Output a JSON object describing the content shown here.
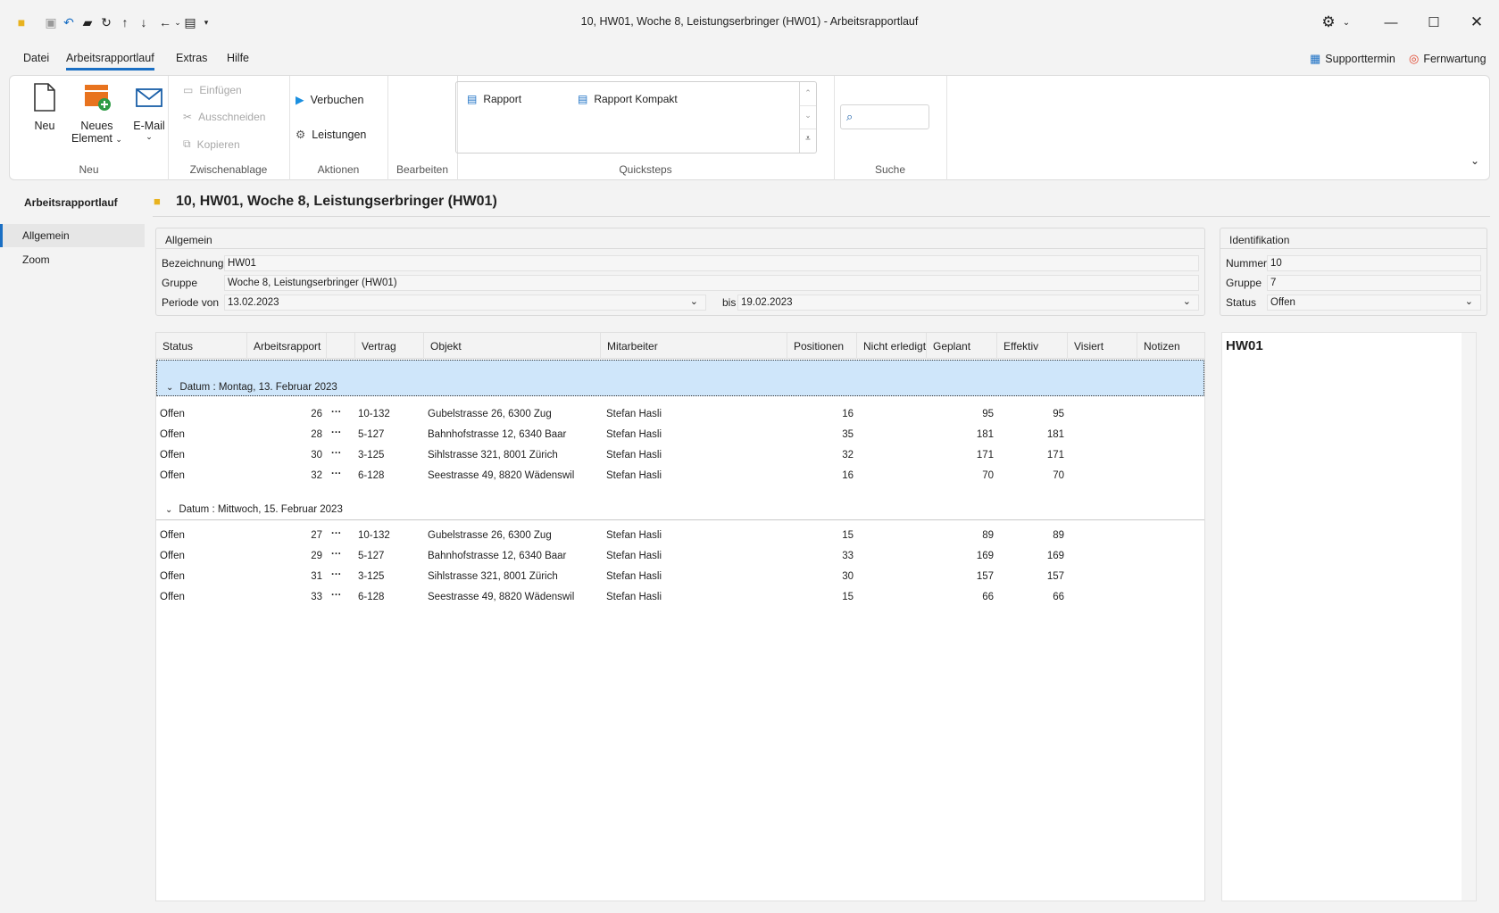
{
  "window": {
    "title": "10, HW01, Woche 8, Leistungserbringer (HW01) - Arbeitsrapportlauf"
  },
  "menu": {
    "tabs": [
      "Datei",
      "Arbeitsrapportlauf",
      "Extras",
      "Hilfe"
    ],
    "supporttermin": "Supporttermin",
    "fernwartung": "Fernwartung"
  },
  "ribbon": {
    "neu": "Neu",
    "neues_element_1": "Neues",
    "neues_element_2": "Element",
    "email": "E-Mail",
    "group_neu": "Neu",
    "einfuegen": "Einfügen",
    "ausschneiden": "Ausschneiden",
    "kopieren": "Kopieren",
    "group_zwischenablage": "Zwischenablage",
    "verbuchen": "Verbuchen",
    "leistungen": "Leistungen",
    "group_aktionen": "Aktionen",
    "group_bearbeiten": "Bearbeiten",
    "rapport": "Rapport",
    "rapport_kompakt": "Rapport Kompakt",
    "group_quicksteps": "Quicksteps",
    "group_suche": "Suche"
  },
  "sidebar": {
    "title": "Arbeitsrapportlauf",
    "items": [
      "Allgemein",
      "Zoom"
    ]
  },
  "page": {
    "title": "10, HW01, Woche 8, Leistungserbringer (HW01)"
  },
  "allgemein": {
    "title": "Allgemein",
    "bezeichnung_label": "Bezeichnung",
    "bezeichnung": "HW01",
    "gruppe_label": "Gruppe",
    "gruppe": "Woche 8, Leistungserbringer (HW01)",
    "periode_label": "Periode von",
    "periode_von": "13.02.2023",
    "bis_label": "bis",
    "bis": "19.02.2023"
  },
  "identifikation": {
    "title": "Identifikation",
    "nummer_label": "Nummer",
    "nummer": "10",
    "gruppe_label": "Gruppe",
    "gruppe": "7",
    "status_label": "Status",
    "status": "Offen"
  },
  "grid": {
    "columns": [
      "Status",
      "Arbeitsrapport",
      "",
      "Vertrag",
      "Objekt",
      "Mitarbeiter",
      "Positionen",
      "Nicht erledigt",
      "Geplant",
      "Effektiv",
      "Visiert",
      "Notizen"
    ],
    "groups": [
      {
        "label": "Datum : Montag, 13. Februar 2023",
        "rows": [
          {
            "status": "Offen",
            "nr": "26",
            "more": "···",
            "vertrag": "10-132",
            "objekt": "Gubelstrasse 26, 6300 Zug",
            "mitarbeiter": "Stefan Hasli",
            "positionen": "16",
            "geplant": "95",
            "effektiv": "95"
          },
          {
            "status": "Offen",
            "nr": "28",
            "more": "···",
            "vertrag": "5-127",
            "objekt": "Bahnhofstrasse 12, 6340 Baar",
            "mitarbeiter": "Stefan Hasli",
            "positionen": "35",
            "geplant": "181",
            "effektiv": "181"
          },
          {
            "status": "Offen",
            "nr": "30",
            "more": "···",
            "vertrag": "3-125",
            "objekt": "Sihlstrasse 321, 8001 Zürich",
            "mitarbeiter": "Stefan Hasli",
            "positionen": "32",
            "geplant": "171",
            "effektiv": "171"
          },
          {
            "status": "Offen",
            "nr": "32",
            "more": "···",
            "vertrag": "6-128",
            "objekt": "Seestrasse 49, 8820 Wädenswil",
            "mitarbeiter": "Stefan Hasli",
            "positionen": "16",
            "geplant": "70",
            "effektiv": "70"
          }
        ]
      },
      {
        "label": "Datum : Mittwoch, 15. Februar 2023",
        "rows": [
          {
            "status": "Offen",
            "nr": "27",
            "more": "···",
            "vertrag": "10-132",
            "objekt": "Gubelstrasse 26, 6300 Zug",
            "mitarbeiter": "Stefan Hasli",
            "positionen": "15",
            "geplant": "89",
            "effektiv": "89"
          },
          {
            "status": "Offen",
            "nr": "29",
            "more": "···",
            "vertrag": "5-127",
            "objekt": "Bahnhofstrasse 12, 6340 Baar",
            "mitarbeiter": "Stefan Hasli",
            "positionen": "33",
            "geplant": "169",
            "effektiv": "169"
          },
          {
            "status": "Offen",
            "nr": "31",
            "more": "···",
            "vertrag": "3-125",
            "objekt": "Sihlstrasse 321, 8001 Zürich",
            "mitarbeiter": "Stefan Hasli",
            "positionen": "30",
            "geplant": "157",
            "effektiv": "157"
          },
          {
            "status": "Offen",
            "nr": "33",
            "more": "···",
            "vertrag": "6-128",
            "objekt": "Seestrasse 49, 8820 Wädenswil",
            "mitarbeiter": "Stefan Hasli",
            "positionen": "15",
            "geplant": "66",
            "effektiv": "66"
          }
        ]
      }
    ]
  },
  "preview": {
    "title": "HW01"
  },
  "colors": {
    "accent": "#1a6fc4",
    "selection": "#cfe6fa",
    "orange": "#e8731e"
  }
}
